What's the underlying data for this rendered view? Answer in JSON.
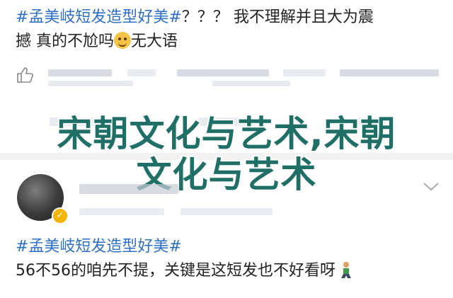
{
  "post1": {
    "hashtag": "#孟美岐短发造型好美#",
    "line1_rest": "？？？ 我不理解并且大为震",
    "line2_a": "撼 真的不尬吗",
    "line2_b": "无大语"
  },
  "overlay": {
    "line1": "宋朝文化与艺术,宋朝",
    "line2": "文化与艺术"
  },
  "post2": {
    "hashtag": "#孟美岐短发造型好美#",
    "text_a": "56不56的咱先不提，关键是这短发也不好看呀"
  },
  "icons": {
    "like": "thumbs-up-icon",
    "chevron": "chevron-down-icon",
    "emoji_grin": "grinning-emoji-icon",
    "emoji_kneel": "kneeling-person-icon"
  },
  "colors": {
    "hashtag": "#2e6fc4",
    "overlay_text": "#1f6f66",
    "divider": "#f2f2f2",
    "verified": "#f4b400"
  }
}
